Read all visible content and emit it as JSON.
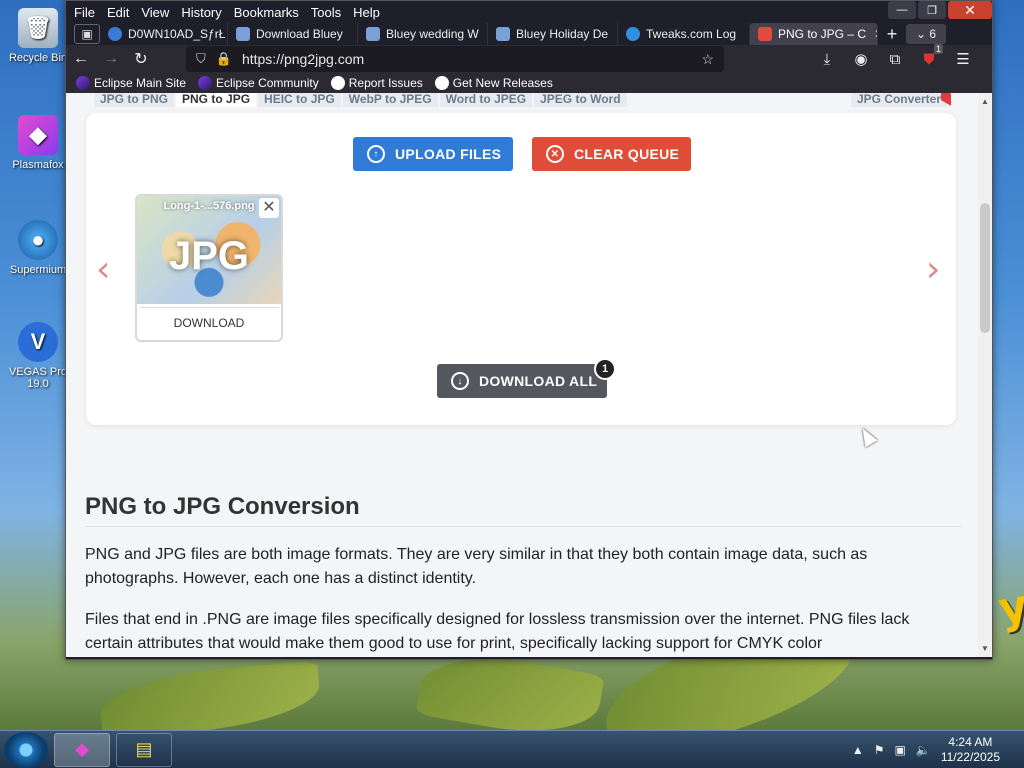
{
  "desktop": {
    "icons": [
      {
        "label": "Recycle Bin",
        "icon": "recycle-bin-icon"
      },
      {
        "label": "Plasmafox",
        "icon": "plasmafox-icon"
      },
      {
        "label": "Supermium",
        "icon": "supermium-icon"
      },
      {
        "label": "VEGAS Pro 19.0",
        "icon": "vegas-pro-icon"
      }
    ],
    "wallpaper_text": "y"
  },
  "window": {
    "menu": [
      "File",
      "Edit",
      "View",
      "History",
      "Bookmarks",
      "Tools",
      "Help"
    ],
    "tabs": [
      {
        "label": "D0WN10AD_SƒrŁ",
        "color": "#3a7bd5"
      },
      {
        "label": "Download Bluey",
        "color": "#7aa0d8"
      },
      {
        "label": "Bluey wedding W",
        "color": "#7aa0d8"
      },
      {
        "label": "Bluey Holiday De",
        "color": "#7aa0d8"
      },
      {
        "label": "Tweaks.com Log",
        "color": "#2f8fe0"
      },
      {
        "label": "PNG to JPG – C",
        "color": "#e24a3b",
        "active": true
      }
    ],
    "tab_count": "6",
    "url": "https://png2jpg.com",
    "bookmarks": [
      {
        "label": "Eclipse Main Site",
        "icon": "eclipse-icon"
      },
      {
        "label": "Eclipse Community",
        "icon": "eclipse-icon"
      },
      {
        "label": "Report Issues",
        "icon": "github-icon"
      },
      {
        "label": "Get New Releases",
        "icon": "github-icon"
      }
    ]
  },
  "page": {
    "conv_tabs": [
      "JPG to PNG",
      "PNG to JPG",
      "HEIC to JPG",
      "WebP to JPEG",
      "Word to JPEG",
      "JPEG to Word"
    ],
    "conv_tab_right": "JPG Converter",
    "upload_label": "UPLOAD FILES",
    "clear_label": "CLEAR QUEUE",
    "file": {
      "name": "Long-1-...576.png",
      "ext": "JPG",
      "download_label": "DOWNLOAD"
    },
    "download_all_label": "DOWNLOAD ALL",
    "download_count": "1",
    "section_title": "PNG to JPG Conversion",
    "para1": "PNG and JPG files are both image formats. They are very similar in that they both contain image data, such as photographs. However, each one has a distinct identity.",
    "para2": "Files that end in .PNG are image files specifically designed for lossless transmission over the internet. PNG files lack certain attributes that would make them good to use for print, specifically lacking support for CMYK color"
  },
  "taskbar": {
    "time": "4:24 AM",
    "date": "11/22/2025"
  }
}
